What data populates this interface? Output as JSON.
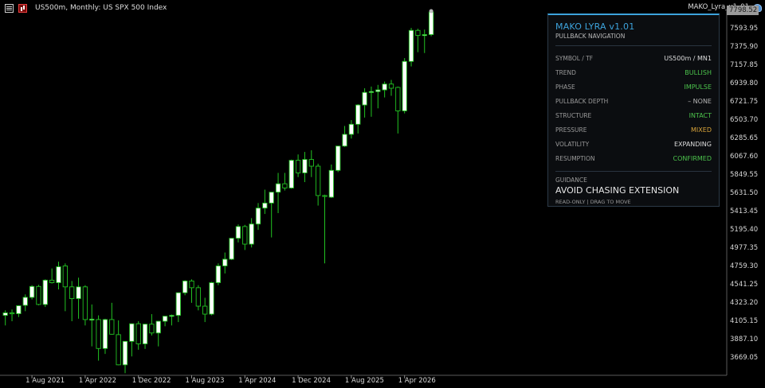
{
  "topbar": {
    "symbol_title": "US500m, Monthly:  US SPX 500 Index",
    "ea_label": "MAKO_Lyra_v1_01",
    "icons": [
      "menu-icon",
      "chart-bars-icon",
      "ea-hat-icon"
    ]
  },
  "price_axis": {
    "labels": [
      "7593.95",
      "7375.90",
      "7157.85",
      "6939.80",
      "6721.75",
      "6503.70",
      "6285.65",
      "6067.60",
      "5849.55",
      "5631.50",
      "5413.45",
      "5195.40",
      "4977.35",
      "4759.30",
      "4541.25",
      "4323.20",
      "4105.15",
      "3887.10",
      "3669.05"
    ],
    "current_price": "7798.52"
  },
  "time_axis": {
    "labels": [
      "1 Aug 2021",
      "1 Apr 2022",
      "1 Dec 2022",
      "1 Aug 2023",
      "1 Apr 2024",
      "1 Dec 2024",
      "1 Aug 2025",
      "1 Apr 2026"
    ]
  },
  "colors": {
    "background": "#000000",
    "bull_candle": "#ffffff",
    "bear_candle": "#000000",
    "candle_outline": "#22c322",
    "accent": "#3da3dc",
    "ok": "#4cc44c",
    "warn": "#d9a43a"
  },
  "panel": {
    "title": "MAKO LYRA v1.01",
    "subtitle": "PULLBACK NAVIGATION",
    "rows": [
      {
        "key": "SYMBOL / TF",
        "value": "US500m / MN1",
        "color": "#dcdcdc"
      },
      {
        "key": "TREND",
        "value": "BULLISH",
        "color": "#4cc44c"
      },
      {
        "key": "PHASE",
        "value": "IMPULSE",
        "color": "#4cc44c"
      },
      {
        "key": "PULLBACK DEPTH",
        "value": "–  NONE",
        "color": "#b4b4b4"
      },
      {
        "key": "STRUCTURE",
        "value": "INTACT",
        "color": "#4cc44c"
      },
      {
        "key": "PRESSURE",
        "value": "MIXED",
        "color": "#d9a43a"
      },
      {
        "key": "VOLATILITY",
        "value": "EXPANDING",
        "color": "#dcdcdc"
      },
      {
        "key": "RESUMPTION",
        "value": "CONFIRMED",
        "color": "#4cc44c"
      }
    ],
    "guidance_label": "GUIDANCE",
    "guidance": "AVOID CHASING EXTENSION",
    "footer": "READ-ONLY  |  DRAG TO MOVE"
  },
  "chart_data": {
    "type": "candlestick",
    "symbol": "US500m",
    "timeframe": "Monthly",
    "first_bar": "2021-04",
    "ylim": [
      3560,
      7810
    ],
    "bars": [
      {
        "o": 4180,
        "h": 4240,
        "l": 4060,
        "c": 4210
      },
      {
        "o": 4210,
        "h": 4250,
        "l": 4110,
        "c": 4205
      },
      {
        "o": 4200,
        "h": 4300,
        "l": 4160,
        "c": 4295
      },
      {
        "o": 4300,
        "h": 4430,
        "l": 4230,
        "c": 4395
      },
      {
        "o": 4395,
        "h": 4540,
        "l": 4370,
        "c": 4525
      },
      {
        "o": 4525,
        "h": 4545,
        "l": 4300,
        "c": 4310
      },
      {
        "o": 4310,
        "h": 4610,
        "l": 4280,
        "c": 4600
      },
      {
        "o": 4600,
        "h": 4740,
        "l": 4560,
        "c": 4570
      },
      {
        "o": 4570,
        "h": 4820,
        "l": 4490,
        "c": 4760
      },
      {
        "o": 4770,
        "h": 4800,
        "l": 4230,
        "c": 4520
      },
      {
        "o": 4520,
        "h": 4590,
        "l": 4110,
        "c": 4380
      },
      {
        "o": 4380,
        "h": 4630,
        "l": 4140,
        "c": 4520
      },
      {
        "o": 4520,
        "h": 4540,
        "l": 4060,
        "c": 4130
      },
      {
        "o": 4130,
        "h": 4310,
        "l": 3810,
        "c": 4135
      },
      {
        "o": 4130,
        "h": 4180,
        "l": 3640,
        "c": 3785
      },
      {
        "o": 3785,
        "h": 4140,
        "l": 3720,
        "c": 4130
      },
      {
        "o": 4130,
        "h": 4330,
        "l": 3950,
        "c": 3955
      },
      {
        "o": 3950,
        "h": 4120,
        "l": 3585,
        "c": 3590
      },
      {
        "o": 3590,
        "h": 3830,
        "l": 3490,
        "c": 3870
      },
      {
        "o": 3870,
        "h": 4080,
        "l": 3690,
        "c": 4080
      },
      {
        "o": 4080,
        "h": 4110,
        "l": 3770,
        "c": 3840
      },
      {
        "o": 3840,
        "h": 4080,
        "l": 3780,
        "c": 4075
      },
      {
        "o": 4075,
        "h": 4195,
        "l": 3940,
        "c": 3970
      },
      {
        "o": 3970,
        "h": 4110,
        "l": 3810,
        "c": 4110
      },
      {
        "o": 4110,
        "h": 4170,
        "l": 4050,
        "c": 4170
      },
      {
        "o": 4170,
        "h": 4190,
        "l": 4060,
        "c": 4180
      },
      {
        "o": 4180,
        "h": 4450,
        "l": 4100,
        "c": 4450
      },
      {
        "o": 4450,
        "h": 4600,
        "l": 4420,
        "c": 4590
      },
      {
        "o": 4590,
        "h": 4610,
        "l": 4330,
        "c": 4510
      },
      {
        "o": 4510,
        "h": 4540,
        "l": 4240,
        "c": 4290
      },
      {
        "o": 4290,
        "h": 4390,
        "l": 4100,
        "c": 4195
      },
      {
        "o": 4195,
        "h": 4580,
        "l": 4180,
        "c": 4570
      },
      {
        "o": 4570,
        "h": 4800,
        "l": 4540,
        "c": 4770
      },
      {
        "o": 4770,
        "h": 4930,
        "l": 4680,
        "c": 4850
      },
      {
        "o": 4850,
        "h": 5100,
        "l": 4840,
        "c": 5100
      },
      {
        "o": 5100,
        "h": 5265,
        "l": 5050,
        "c": 5240
      },
      {
        "o": 5240,
        "h": 5260,
        "l": 4960,
        "c": 5030
      },
      {
        "o": 5030,
        "h": 5340,
        "l": 4990,
        "c": 5270
      },
      {
        "o": 5270,
        "h": 5520,
        "l": 5200,
        "c": 5460
      },
      {
        "o": 5460,
        "h": 5680,
        "l": 5390,
        "c": 5520
      },
      {
        "o": 5520,
        "h": 5650,
        "l": 5110,
        "c": 5650
      },
      {
        "o": 5650,
        "h": 5880,
        "l": 5400,
        "c": 5750
      },
      {
        "o": 5750,
        "h": 5880,
        "l": 5670,
        "c": 5700
      },
      {
        "o": 5700,
        "h": 6040,
        "l": 5690,
        "c": 6030
      },
      {
        "o": 6030,
        "h": 6100,
        "l": 5830,
        "c": 5880
      },
      {
        "o": 5880,
        "h": 6130,
        "l": 5770,
        "c": 6040
      },
      {
        "o": 6040,
        "h": 6150,
        "l": 5830,
        "c": 5960
      },
      {
        "o": 5960,
        "h": 5990,
        "l": 5490,
        "c": 5610
      },
      {
        "o": 5610,
        "h": 5620,
        "l": 4800,
        "c": 5600
      },
      {
        "o": 5590,
        "h": 5980,
        "l": 5580,
        "c": 5910
      },
      {
        "o": 5910,
        "h": 6170,
        "l": 5890,
        "c": 6200
      },
      {
        "o": 6200,
        "h": 6440,
        "l": 6190,
        "c": 6340
      },
      {
        "o": 6340,
        "h": 6510,
        "l": 6290,
        "c": 6460
      },
      {
        "o": 6460,
        "h": 6700,
        "l": 6350,
        "c": 6690
      },
      {
        "o": 6690,
        "h": 6890,
        "l": 6540,
        "c": 6840
      },
      {
        "o": 6840,
        "h": 6910,
        "l": 6550,
        "c": 6850
      },
      {
        "o": 6850,
        "h": 6930,
        "l": 6650,
        "c": 6870
      },
      {
        "o": 6870,
        "h": 6970,
        "l": 6780,
        "c": 6940
      },
      {
        "o": 6940,
        "h": 6990,
        "l": 6800,
        "c": 6890
      },
      {
        "o": 6900,
        "h": 6910,
        "l": 6350,
        "c": 6620
      },
      {
        "o": 6620,
        "h": 7250,
        "l": 6590,
        "c": 7210
      },
      {
        "o": 7210,
        "h": 7610,
        "l": 7150,
        "c": 7580
      },
      {
        "o": 7580,
        "h": 7600,
        "l": 7320,
        "c": 7520
      },
      {
        "o": 7520,
        "h": 7590,
        "l": 7310,
        "c": 7530
      },
      {
        "o": 7530,
        "h": 7800,
        "l": 7510,
        "c": 7798.52
      }
    ]
  }
}
